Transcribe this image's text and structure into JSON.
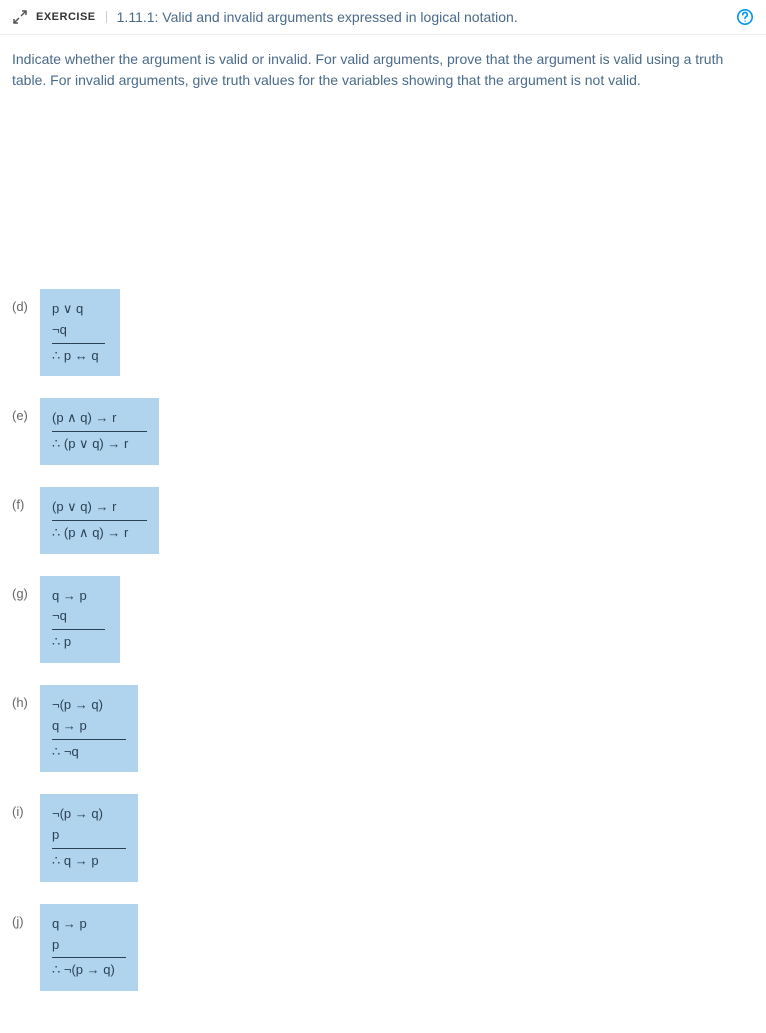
{
  "header": {
    "exercise_label": "EXERCISE",
    "title": "1.11.1: Valid and invalid arguments expressed in logical notation."
  },
  "instructions": "Indicate whether the argument is valid or invalid. For valid arguments, prove that the argument is valid using a truth table. For invalid arguments, give truth values for the variables showing that the argument is not valid.",
  "problems": [
    {
      "label": "(d)",
      "premises": [
        "p ∨ q",
        "¬q"
      ],
      "conclusion": "p ↔ q"
    },
    {
      "label": "(e)",
      "premises": [
        "(p ∧ q) → r"
      ],
      "conclusion": "(p ∨ q) → r"
    },
    {
      "label": "(f)",
      "premises": [
        "(p ∨ q) → r"
      ],
      "conclusion": "(p ∧ q) → r"
    },
    {
      "label": "(g)",
      "premises": [
        "q → p",
        "¬q"
      ],
      "conclusion": "p"
    },
    {
      "label": "(h)",
      "premises": [
        "¬(p → q)",
        "q → p"
      ],
      "conclusion": "¬q"
    },
    {
      "label": "(i)",
      "premises": [
        "¬(p → q)",
        "p"
      ],
      "conclusion": "q → p"
    },
    {
      "label": "(j)",
      "premises": [
        "q → p",
        "p"
      ],
      "conclusion": "¬(p → q)"
    }
  ]
}
